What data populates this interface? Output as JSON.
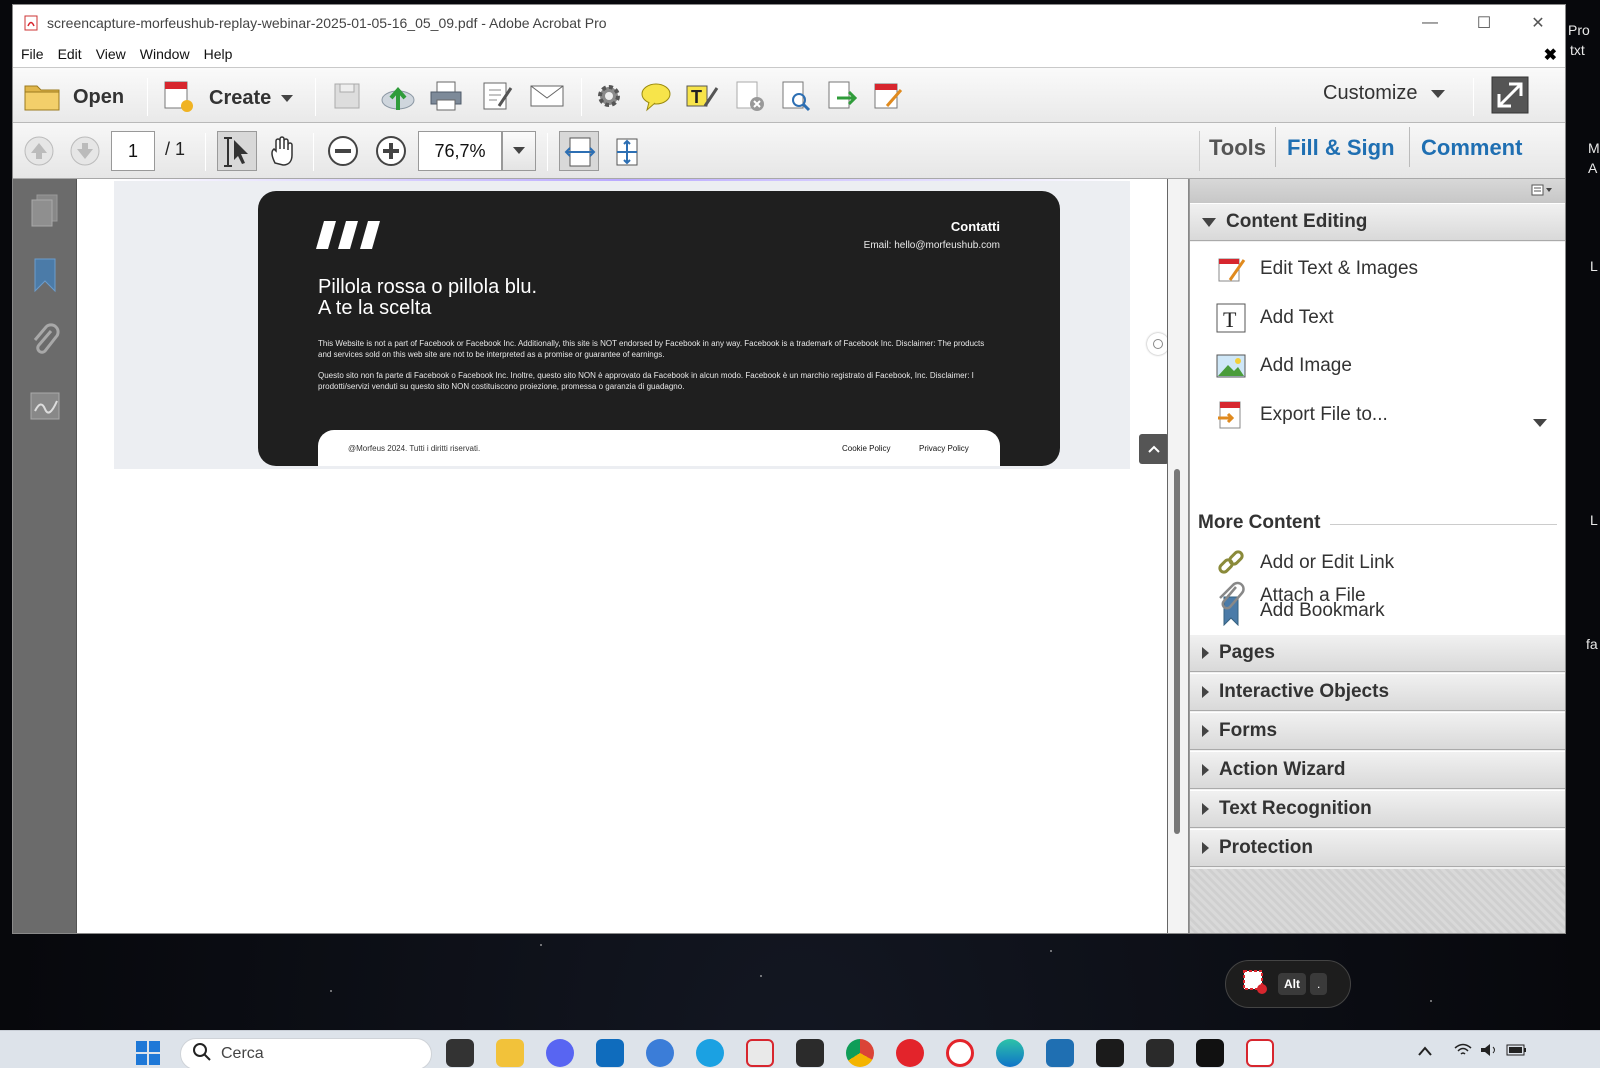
{
  "window": {
    "title": "screencapture-morfeushub-replay-webinar-2025-01-05-16_05_09.pdf - Adobe Acrobat Pro",
    "minimize_label": "—",
    "maximize_label": "☐",
    "close_label": "✕"
  },
  "menu": {
    "items": [
      "File",
      "Edit",
      "View",
      "Window",
      "Help"
    ],
    "close_doc": "✖"
  },
  "toolbar": {
    "open_label": "Open",
    "create_label": "Create",
    "customize_label": "Customize"
  },
  "nav": {
    "page_current": "1",
    "page_total": "/ 1",
    "zoom": "76,7%"
  },
  "panel_tabs": {
    "tools": "Tools",
    "fill_sign": "Fill & Sign",
    "comment": "Comment"
  },
  "document": {
    "contact_heading": "Contatti",
    "contact_email": "Email: hello@morfeushub.com",
    "headline_line1": "Pillola rossa o pillola blu.",
    "headline_line2": "A te la scelta",
    "disclaimer_en": "This Website is not a part of Facebook or Facebook Inc. Additionally, this site is NOT endorsed by Facebook in any way. Facebook is a trademark of Facebook Inc. Disclaimer: The products and services sold on this web site are not to be interpreted as a promise or guarantee of earnings.",
    "disclaimer_it": "Questo sito non fa parte di Facebook o Facebook Inc. Inoltre, questo sito NON è approvato da Facebook in alcun modo. Facebook è un marchio registrato di Facebook, Inc. Disclaimer: I prodotti/servizi venduti su questo sito NON costituiscono proiezione, promessa o garanzia di guadagno.",
    "copyright": "@Morfeus 2024. Tutti i diritti riservati.",
    "cookie_policy": "Cookie Policy",
    "privacy_policy": "Privacy Policy"
  },
  "tools_pane": {
    "content_editing": {
      "heading": "Content Editing",
      "items": [
        "Edit Text & Images",
        "Add Text",
        "Add Image",
        "Export File to..."
      ]
    },
    "more_content": {
      "heading": "More Content",
      "items": [
        "Add or Edit Link",
        "Add Bookmark",
        "Attach a File"
      ]
    },
    "sections": [
      "Pages",
      "Interactive Objects",
      "Forms",
      "Action Wizard",
      "Text Recognition",
      "Protection"
    ]
  },
  "alt_widget": {
    "key1": "Alt",
    "key2": "."
  },
  "taskbar": {
    "search_placeholder": "Cerca"
  },
  "desktop_edge_text": [
    "Pro",
    "txt",
    "M",
    "A",
    "L",
    "L",
    "fa"
  ],
  "colors": {
    "acrobat_red": "#d7262e",
    "panel_tab_blue": "#1f6fb2",
    "site_footer_bg": "#1f1f1f"
  }
}
